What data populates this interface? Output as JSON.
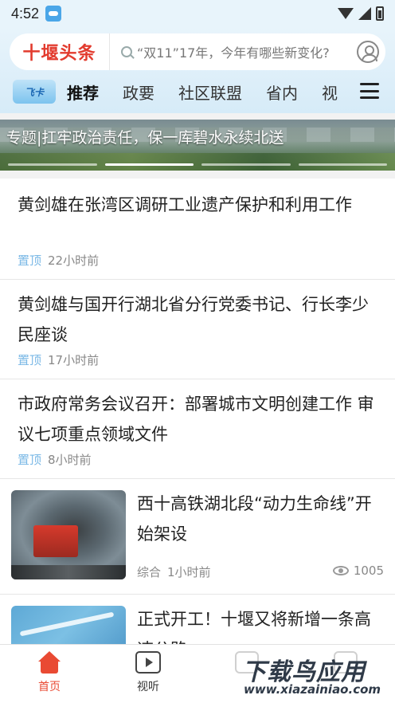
{
  "status_bar": {
    "time": "4:52"
  },
  "header": {
    "logo": "十堰头条",
    "search_placeholder": "“双11”17年，今年有哪些新变化?",
    "feika_label": "飞卡",
    "tabs": [
      {
        "label": "推荐",
        "active": true
      },
      {
        "label": "政要",
        "active": false
      },
      {
        "label": "社区联盟",
        "active": false
      },
      {
        "label": "省内",
        "active": false
      },
      {
        "label": "视",
        "active": false
      }
    ]
  },
  "banner": {
    "title": "专题|扛牢政治责任，保一库碧水永续北送",
    "page_indicator": {
      "count": 4,
      "active_index": 1
    }
  },
  "feed": {
    "items": [
      {
        "title": "黄剑雄在张湾区调研工业遗产保护和利用工作",
        "tag": "置顶",
        "time": "22小时前"
      },
      {
        "title": "黄剑雄与国开行湖北省分行党委书记、行长李少民座谈",
        "tag": "置顶",
        "time": "17小时前"
      },
      {
        "title": "市政府常务会议召开：部署城市文明创建工作 审议七项重点领域文件",
        "tag": "置顶",
        "time": "8小时前"
      }
    ],
    "cards": [
      {
        "title": "西十高铁湖北段“动力生命线”开始架设",
        "category": "综合",
        "time": "1小时前",
        "views": "1005"
      },
      {
        "title": "正式开工！十堰又将新增一条高速公路",
        "category": "",
        "time": "",
        "views": ""
      }
    ]
  },
  "bottom_nav": {
    "items": [
      {
        "label": "首页",
        "active": true
      },
      {
        "label": "视听",
        "active": false
      },
      {
        "label": "",
        "active": false
      },
      {
        "label": "",
        "active": false
      }
    ]
  },
  "watermark": {
    "big": "下载鸟应用",
    "small": "www.xiazainiao.com"
  },
  "colors": {
    "brand_red": "#e23b2e",
    "accent_blue": "#7ab8e6",
    "nav_active": "#e94a33"
  }
}
